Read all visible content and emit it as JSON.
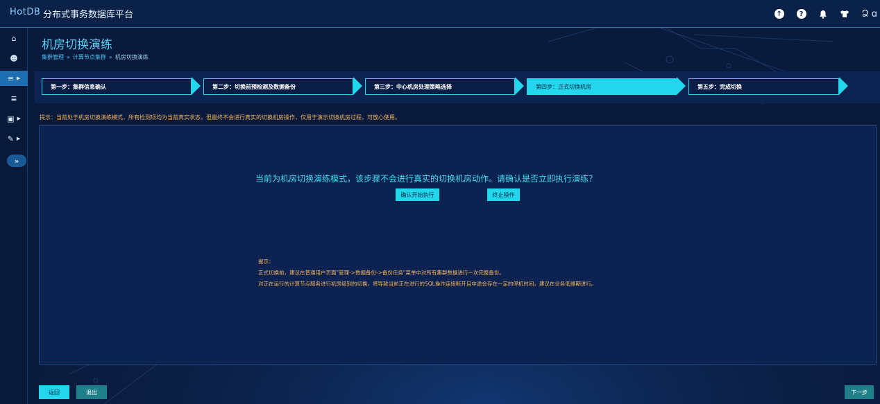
{
  "header": {
    "logo_text": "HotDB",
    "app_title": "分布式事务数据库平台",
    "user_label": "Ձ ɑ",
    "icons": [
      "upload-icon",
      "help-icon",
      "bell-icon",
      "shirt-icon",
      "user-icon"
    ]
  },
  "sidebar": {
    "items": [
      {
        "icon": "home-icon",
        "glyph": "⌂"
      },
      {
        "icon": "users-icon",
        "glyph": "☻"
      },
      {
        "icon": "servers-icon",
        "glyph": "≡"
      },
      {
        "icon": "database-icon",
        "glyph": "≣"
      },
      {
        "icon": "save-icon",
        "glyph": "▣"
      },
      {
        "icon": "wrench-icon",
        "glyph": "✎"
      }
    ],
    "expand_label": "»"
  },
  "page": {
    "title": "机房切换演练",
    "breadcrumb": [
      "集群管理",
      "计算节点集群",
      "机房切换演练"
    ],
    "breadcrumb_sep": "»"
  },
  "steps": [
    {
      "label": "第一步：集群信息确认",
      "active": false
    },
    {
      "label": "第二步：切换前预检测及数据备份",
      "active": false
    },
    {
      "label": "第三步：中心机房处理策略选择",
      "active": false
    },
    {
      "label": "第四步：正式切换机房",
      "active": true
    },
    {
      "label": "第五步：完成切换",
      "active": false
    }
  ],
  "hint_text": "提示：当前处于机房切换演练模式，所有检测项均为当前真实状态，但最终不会进行真实的切换机房操作，仅用于演示切换机房过程，可放心使用。",
  "main": {
    "confirm_message": "当前为机房切换演练模式，该步骤不会进行真实的切换机房动作。请确认是否立即执行演练？",
    "confirm_button": "确认开始执行",
    "stop_button": "终止操作",
    "notes_title": "提示：",
    "notes": [
      "正式切换前，建议在普通用户页面\"管理->数据备份->备份任务\"菜单中对所有集群数据进行一次完整备份。",
      "对正在运行的计算节点服务进行机房级别的切换，将导致当前正在进行的SQL操作连接断开且中途会存在一定的停机时间，建议在业务低峰期进行。"
    ]
  },
  "footer": {
    "back_button": "返回",
    "exit_button": "退出",
    "next_button": "下一步"
  },
  "colors": {
    "accent": "#22d6ec",
    "background": "#0a1a3c",
    "warning_text": "#f0b25a",
    "secondary_button": "#1e7f88"
  }
}
